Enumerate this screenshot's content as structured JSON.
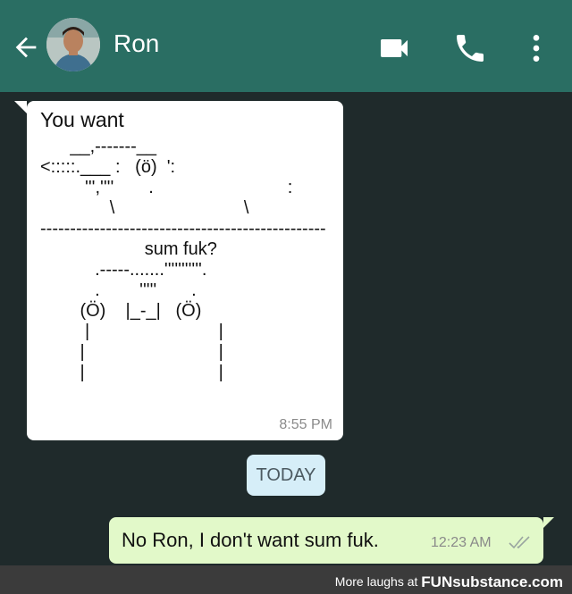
{
  "header": {
    "contact_name": "Ron",
    "icons": [
      "back-arrow-icon",
      "video-call-icon",
      "phone-icon",
      "more-options-icon"
    ]
  },
  "incoming": {
    "text": "You want",
    "ascii_art": "      __,-------__\n<:::::.___ :   (ö)  ':\n         ''',''''       .                           :\n              \\                          \\\n------------------------------------------------\n                     sum fuk?\n           .-----.......'''''''''''.\n           .        '''''       .\n        (Ö)    |_-_|   (Ö)\n         |                          |\n        |                           |\n        |                           |",
    "time": "8:55 PM"
  },
  "date_chip": "TODAY",
  "outgoing": {
    "text": "No Ron, I don't want sum fuk.",
    "time": "12:23 AM"
  },
  "footer": {
    "prefix": "More laughs at",
    "site": "FUNsubstance.com"
  },
  "colors": {
    "header_bg": "#2a6e63",
    "chat_bg": "#1f2a2b",
    "incoming_bubble": "#ffffff",
    "outgoing_bubble": "#e2f9c9",
    "date_chip": "#d6eef8",
    "footer_bg": "#3b3b3b"
  }
}
